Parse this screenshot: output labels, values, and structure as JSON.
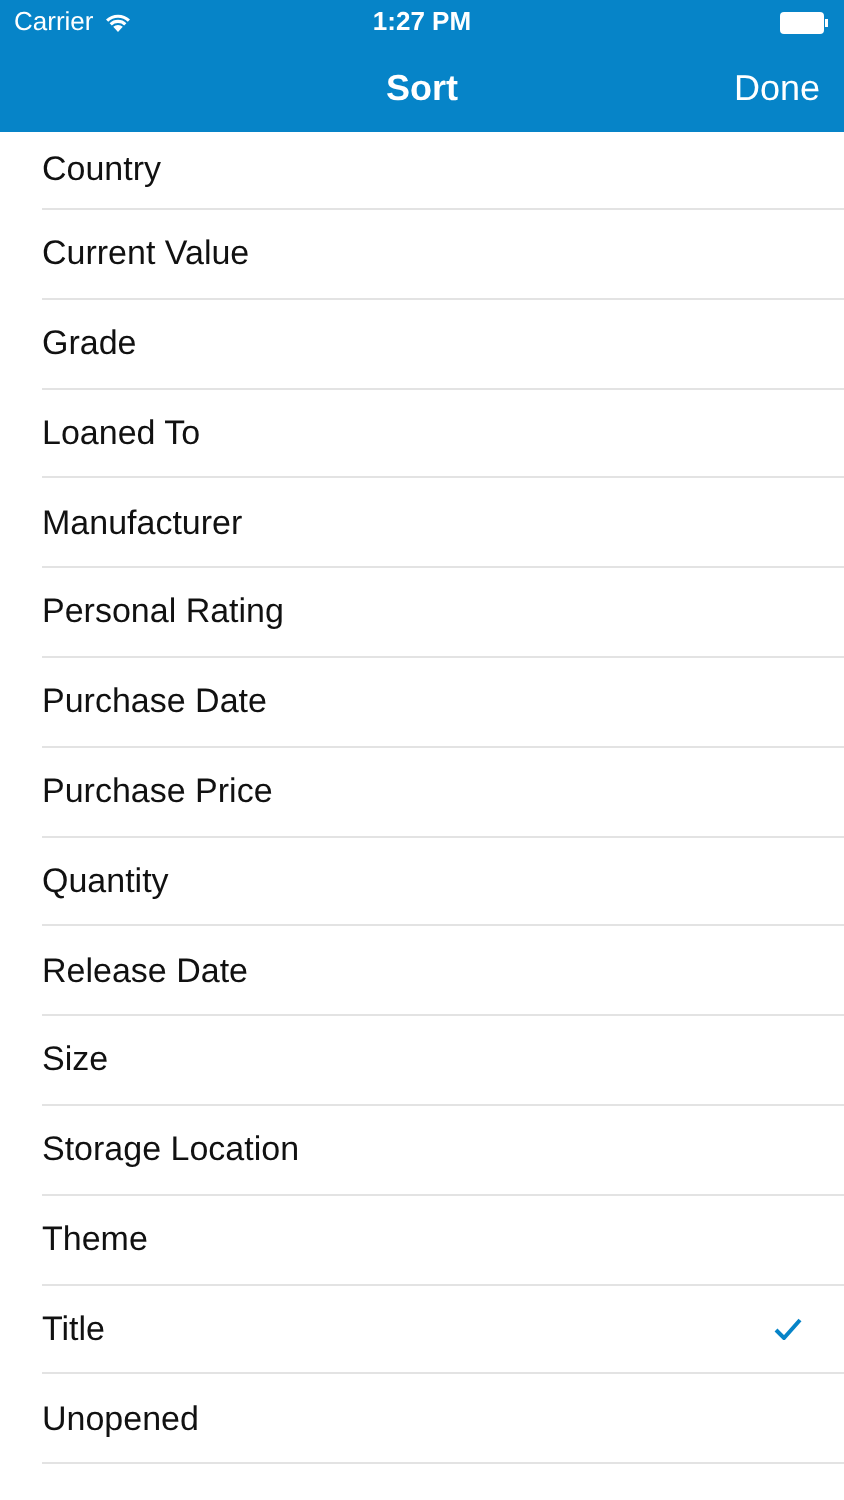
{
  "status_bar": {
    "carrier": "Carrier",
    "time": "1:27 PM"
  },
  "nav_bar": {
    "title": "Sort",
    "done": "Done"
  },
  "options": [
    {
      "label": "Country",
      "selected": false
    },
    {
      "label": "Current Value",
      "selected": false
    },
    {
      "label": "Grade",
      "selected": false
    },
    {
      "label": "Loaned To",
      "selected": false
    },
    {
      "label": "Manufacturer",
      "selected": false
    },
    {
      "label": "Personal Rating",
      "selected": false
    },
    {
      "label": "Purchase Date",
      "selected": false
    },
    {
      "label": "Purchase Price",
      "selected": false
    },
    {
      "label": "Quantity",
      "selected": false
    },
    {
      "label": "Release Date",
      "selected": false
    },
    {
      "label": "Size",
      "selected": false
    },
    {
      "label": "Storage Location",
      "selected": false
    },
    {
      "label": "Theme",
      "selected": false
    },
    {
      "label": "Title",
      "selected": true
    },
    {
      "label": "Unopened",
      "selected": false
    }
  ]
}
